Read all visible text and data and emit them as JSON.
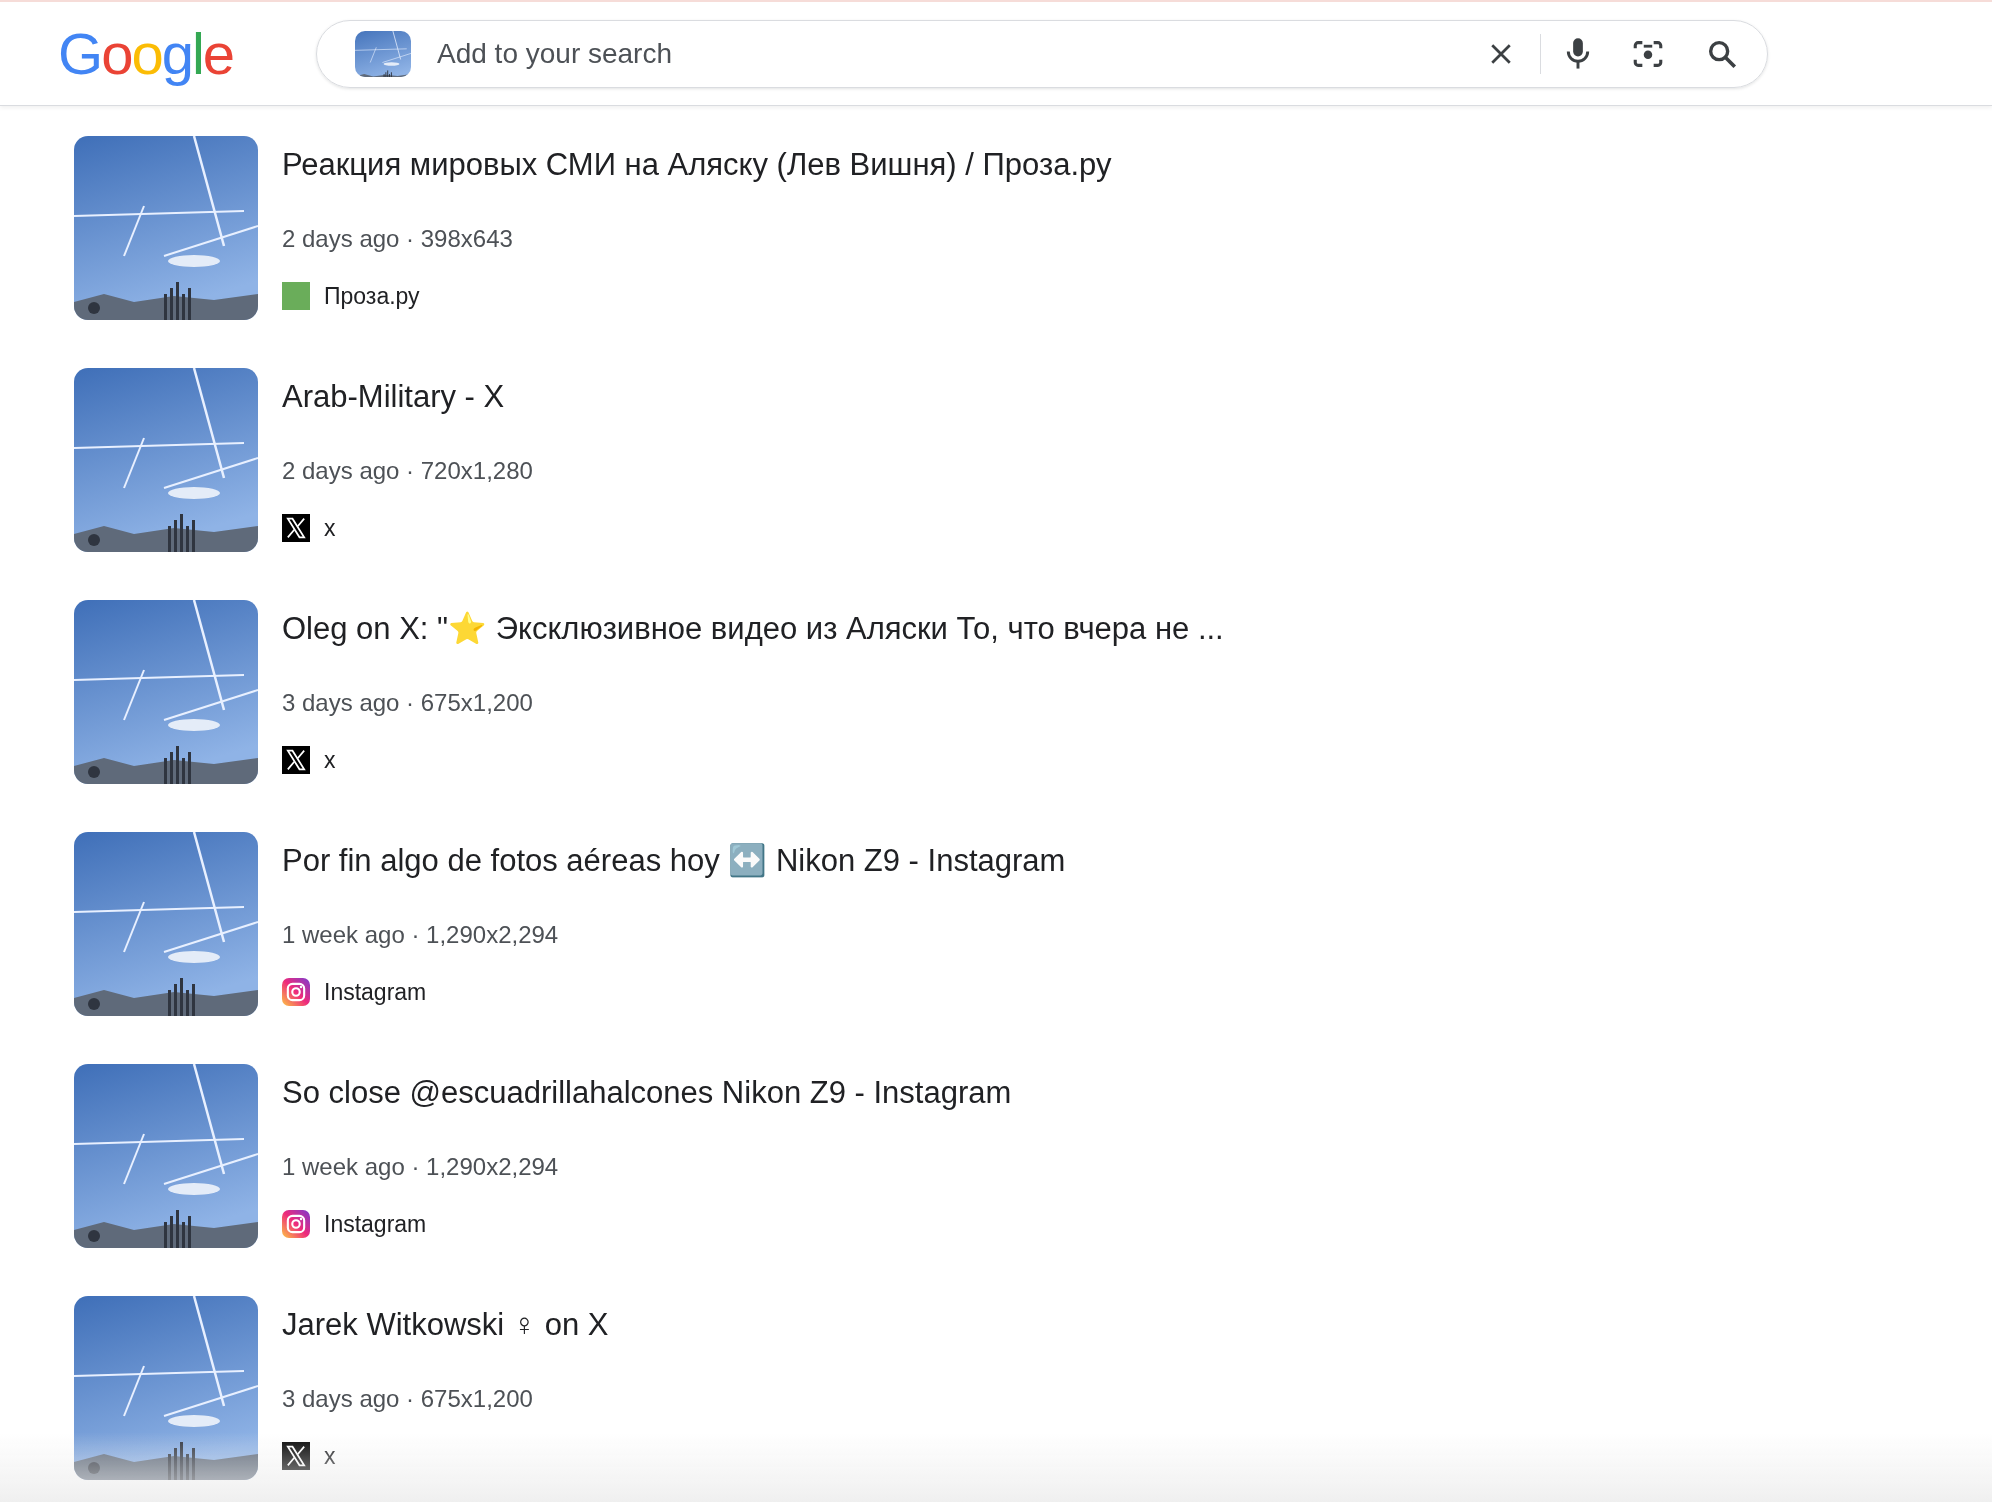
{
  "logo": "Google",
  "search": {
    "placeholder": "Add to your search"
  },
  "results": [
    {
      "title": "Реакция мировых СМИ на Аляску (Лев Вишня) / Проза.ру",
      "meta": "2 days ago · 398x643",
      "source": {
        "name": "Проза.ру",
        "kind": "square",
        "color": "#6aad5a"
      }
    },
    {
      "title": "Arab-Military - X",
      "meta": "2 days ago · 720x1,280",
      "source": {
        "name": "x",
        "kind": "x"
      }
    },
    {
      "title": "Oleg on X: \"⭐ Эксклюзивное видео из Аляски То, что вчера не ...",
      "meta": "3 days ago · 675x1,200",
      "source": {
        "name": "x",
        "kind": "x"
      }
    },
    {
      "title": "Por fin algo de fotos aéreas hoy ↔️ Nikon Z9 - Instagram",
      "meta": "1 week ago · 1,290x2,294",
      "source": {
        "name": "Instagram",
        "kind": "instagram"
      }
    },
    {
      "title": "So close @escuadrillahalcones Nikon Z9 - Instagram",
      "meta": "1 week ago · 1,290x2,294",
      "source": {
        "name": "Instagram",
        "kind": "instagram"
      }
    },
    {
      "title": "Jarek Witkowski ♀ on X",
      "meta": "3 days ago · 675x1,200",
      "source": {
        "name": "x",
        "kind": "x"
      }
    }
  ]
}
